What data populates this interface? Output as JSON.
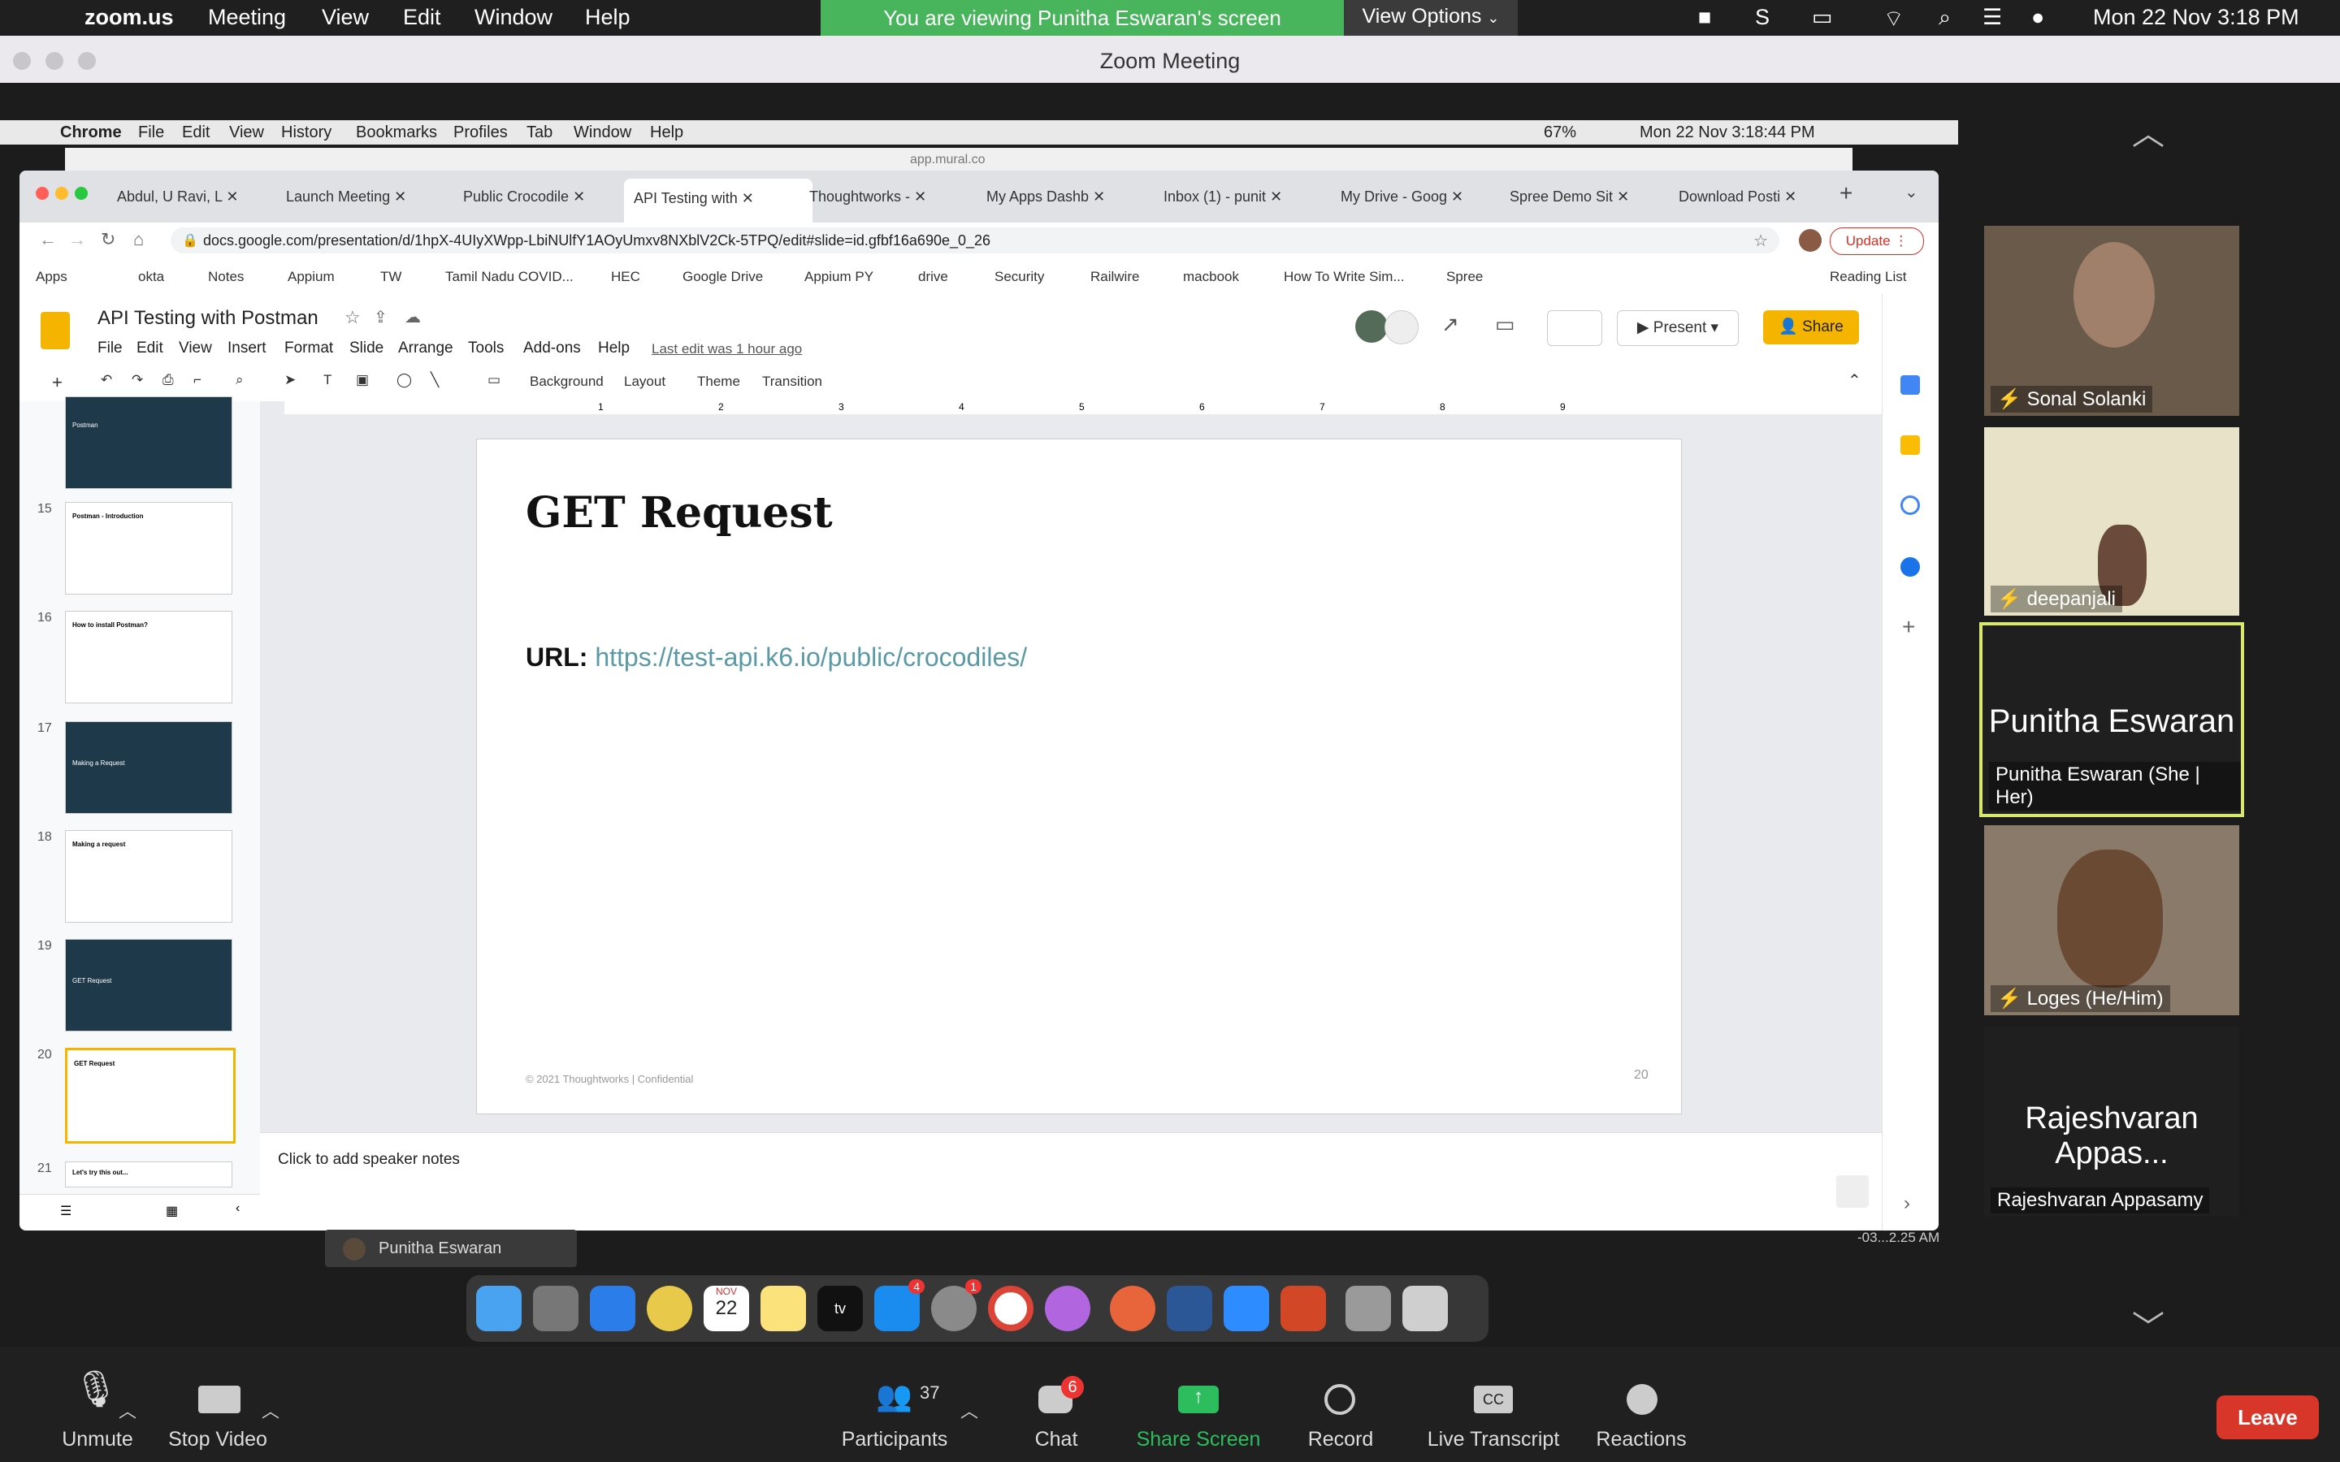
{
  "mac_menubar": {
    "app": "zoom.us",
    "menus": [
      "Meeting",
      "View",
      "Edit",
      "Window",
      "Help"
    ],
    "banner": "You are viewing Punitha Eswaran's screen",
    "view_options": "View Options",
    "clock": "Mon 22 Nov  3:18 PM"
  },
  "zoom_window": {
    "title": "Zoom Meeting"
  },
  "shared_screen": {
    "menubar": {
      "app": "Chrome",
      "menus": [
        "File",
        "Edit",
        "View",
        "History",
        "Bookmarks",
        "Profiles",
        "Tab",
        "Window",
        "Help"
      ],
      "battery": "67%",
      "clock": "Mon 22 Nov  3:18:44 PM"
    },
    "behind_window_url": "app.mural.co",
    "tabs": [
      {
        "label": "Abdul, U Ravi, L"
      },
      {
        "label": "Launch Meeting"
      },
      {
        "label": "Public Crocodile"
      },
      {
        "label": "API Testing with",
        "active": true
      },
      {
        "label": "Thoughtworks -"
      },
      {
        "label": "My Apps Dashb"
      },
      {
        "label": "Inbox (1) - punit"
      },
      {
        "label": "My Drive - Goog"
      },
      {
        "label": "Spree Demo Sit"
      },
      {
        "label": "Download Posti"
      }
    ],
    "address": "docs.google.com/presentation/d/1hpX-4UIyXWpp-LbiNUlfY1AOyUmxv8NXblV2Ck-5TPQ/edit#slide=id.gfbf16a690e_0_26",
    "update_label": "Update",
    "bookmarks": [
      "Apps",
      "okta",
      "Notes",
      "Appium",
      "TW",
      "Tamil Nadu COVID...",
      "HEC",
      "Google Drive",
      "Appium PY",
      "drive",
      "Security",
      "Railwire",
      "macbook",
      "How To Write Sim...",
      "Spree"
    ],
    "reading_list": "Reading List",
    "doc_title": "API Testing with Postman",
    "doc_menus": [
      "File",
      "Edit",
      "View",
      "Insert",
      "Format",
      "Slide",
      "Arrange",
      "Tools",
      "Add-ons",
      "Help"
    ],
    "last_edit": "Last edit was 1 hour ago",
    "present_label": "Present",
    "share_label": "Share",
    "toolbar_buttons": [
      "Background",
      "Layout",
      "Theme",
      "Transition"
    ],
    "ruler_ticks": [
      "1",
      "2",
      "3",
      "4",
      "5",
      "6",
      "7",
      "8",
      "9"
    ],
    "thumbnails": [
      {
        "num": "",
        "title": "Postman",
        "dark": true
      },
      {
        "num": "15",
        "title": "Postman - Introduction",
        "dark": false
      },
      {
        "num": "16",
        "title": "How to install Postman?",
        "dark": false
      },
      {
        "num": "17",
        "title": "Making a Request",
        "dark": true
      },
      {
        "num": "18",
        "title": "Making a request",
        "dark": false
      },
      {
        "num": "19",
        "title": "GET Request",
        "dark": true
      },
      {
        "num": "20",
        "title": "GET Request",
        "dark": false,
        "selected": true
      },
      {
        "num": "21",
        "title": "Let's try this out...",
        "dark": false
      }
    ],
    "slide": {
      "heading": "GET Request",
      "url_label": "URL:",
      "url": "https://test-api.k6.io/public/crocodiles/",
      "footer": "© 2021 Thoughtworks  |  Confidential",
      "page_num": "20"
    },
    "speaker_notes_placeholder": "Click to add speaker notes",
    "presenter_label": "Punitha Eswaran",
    "clipped_clock": "-03...2.25 AM"
  },
  "participants": [
    {
      "name": "Sonal Solanki",
      "muted": true,
      "video": true
    },
    {
      "name": "deepanjali",
      "muted": true,
      "video": true
    },
    {
      "name": "Punitha Eswaran  (She | Her)",
      "display": "Punitha Eswaran",
      "muted": false,
      "video": false,
      "active": true
    },
    {
      "name": "Loges  (He/Him)",
      "muted": true,
      "video": true
    },
    {
      "name": "Rajeshvaran Appasamy",
      "display": "Rajeshvaran Appas...",
      "muted": false,
      "video": false
    }
  ],
  "controls": {
    "unmute": "Unmute",
    "stop_video": "Stop Video",
    "participants": "Participants",
    "participants_count": "37",
    "chat": "Chat",
    "chat_badge": "6",
    "share_screen": "Share Screen",
    "record": "Record",
    "live_transcript": "Live Transcript",
    "reactions": "Reactions",
    "leave": "Leave"
  },
  "dock_badges": {
    "appstore": "4",
    "settings": "1"
  },
  "calendar_icon": {
    "month": "NOV",
    "day": "22"
  },
  "colors": {
    "zoom_green": "#48b45c",
    "share_green": "#2dbd5f",
    "leave_red": "#d9362a",
    "active_speaker": "#d7e86c",
    "slides_yellow": "#f4b400",
    "link_teal": "#5a9aa6"
  }
}
